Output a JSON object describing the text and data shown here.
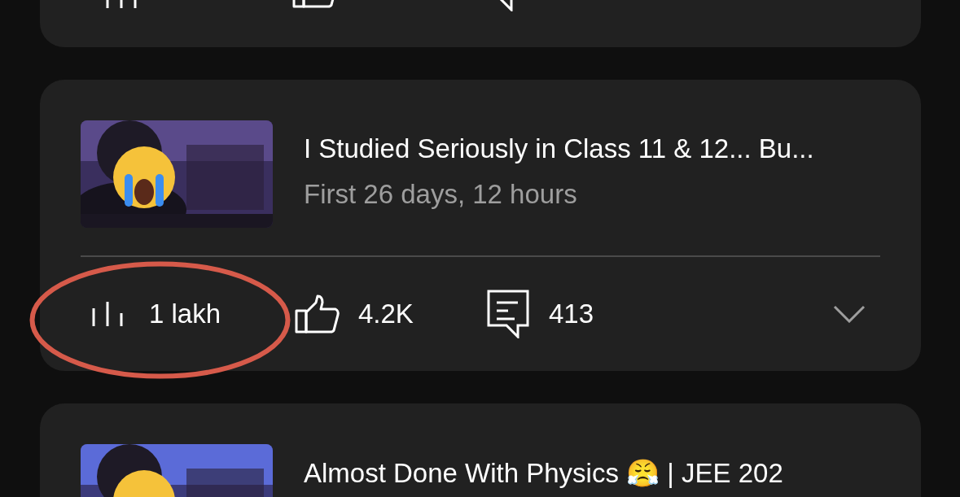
{
  "videos": [
    {
      "title": "I Studied Seriously in Class 11 & 12... Bu...",
      "subtitle": "First 26 days, 12 hours",
      "views": "1 lakh",
      "likes": "4.2K",
      "comments": "413",
      "highlighted": true
    },
    {
      "title": "Almost Done With Physics 😤 | JEE 202"
    }
  ]
}
